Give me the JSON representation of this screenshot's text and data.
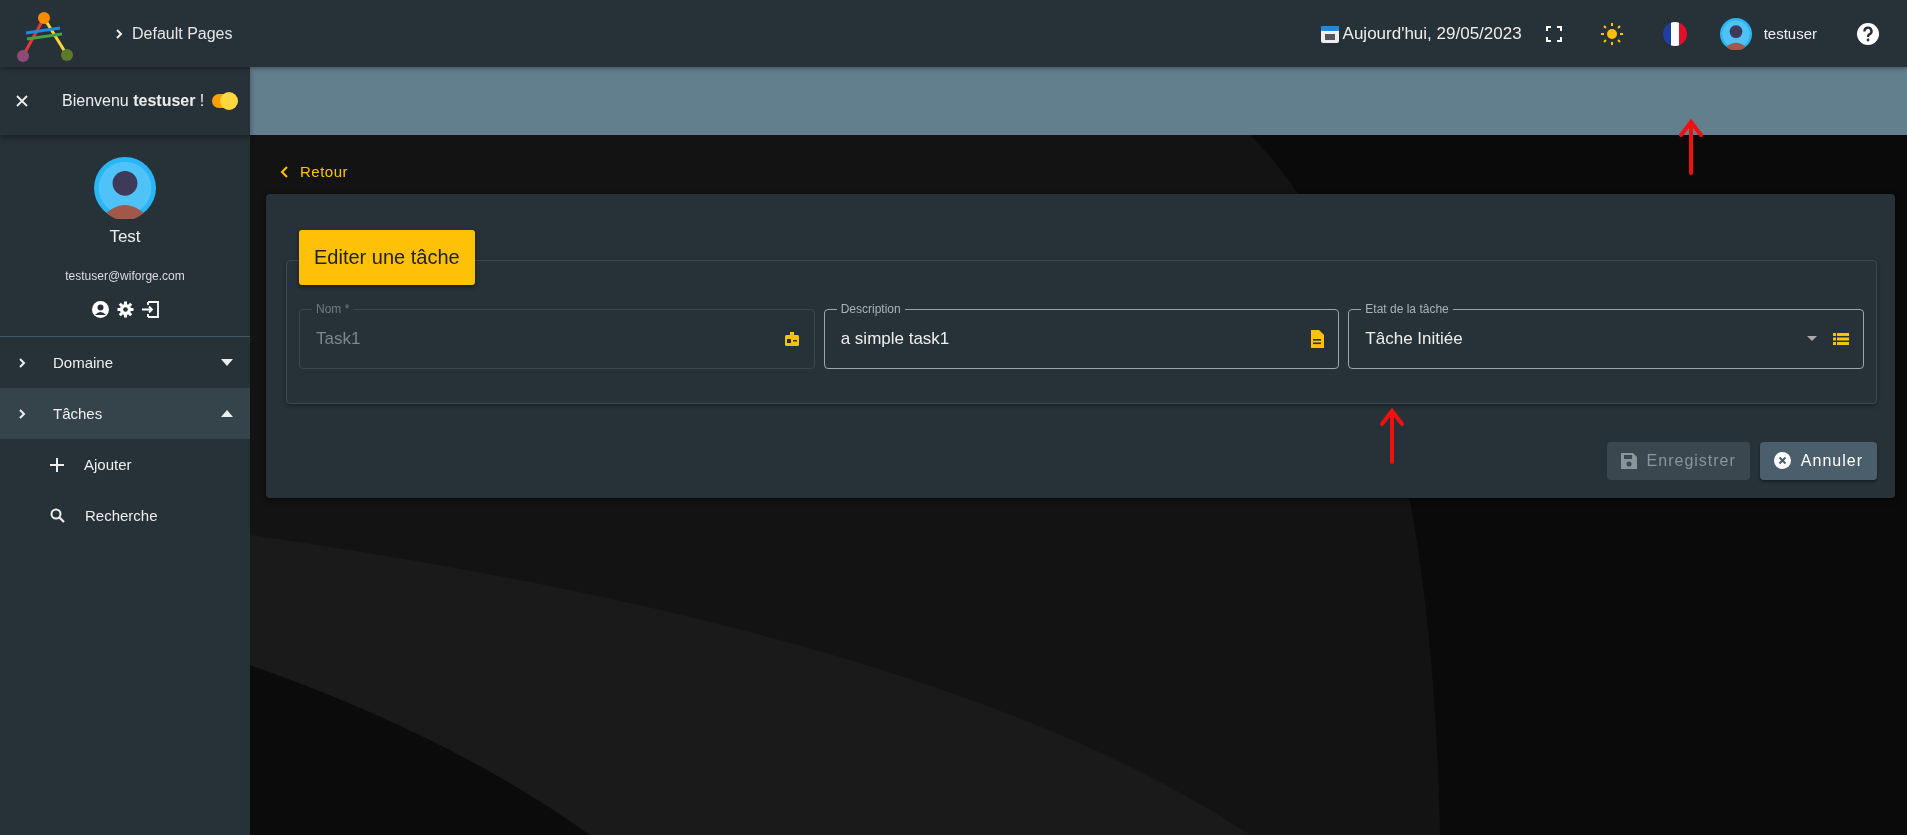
{
  "topbar": {
    "breadcrumb": "Default Pages",
    "date": "Aujourd'hui, 29/05/2023",
    "username": "testuser"
  },
  "sidebar": {
    "welcome": "Bienvenu **testuser** !",
    "toggle_on": true,
    "profile": {
      "name": "Test",
      "email": "testuser@wiforge.com"
    },
    "menu": [
      {
        "label": "Domaine",
        "expanded": false,
        "selected": false
      },
      {
        "label": "Tâches",
        "expanded": true,
        "selected": true,
        "children": [
          {
            "label": "Ajouter",
            "kind": "add"
          },
          {
            "label": "Recherche",
            "kind": "search"
          }
        ]
      }
    ]
  },
  "back_link": "Retour",
  "form": {
    "title": "Editer une tâche",
    "fields": [
      {
        "kind": "text",
        "label": "Nom *",
        "value": "Task1",
        "disabled": true
      },
      {
        "kind": "text",
        "label": "Description",
        "value": "a simple task1",
        "disabled": false
      },
      {
        "kind": "select",
        "label": "Etat de la tâche",
        "value": "Tâche Initiée",
        "disabled": false
      }
    ],
    "buttons": [
      {
        "kind": "save",
        "label": "Enregistrer",
        "disabled": true
      },
      {
        "kind": "cancel",
        "label": "Annuler",
        "disabled": false
      }
    ]
  }
}
